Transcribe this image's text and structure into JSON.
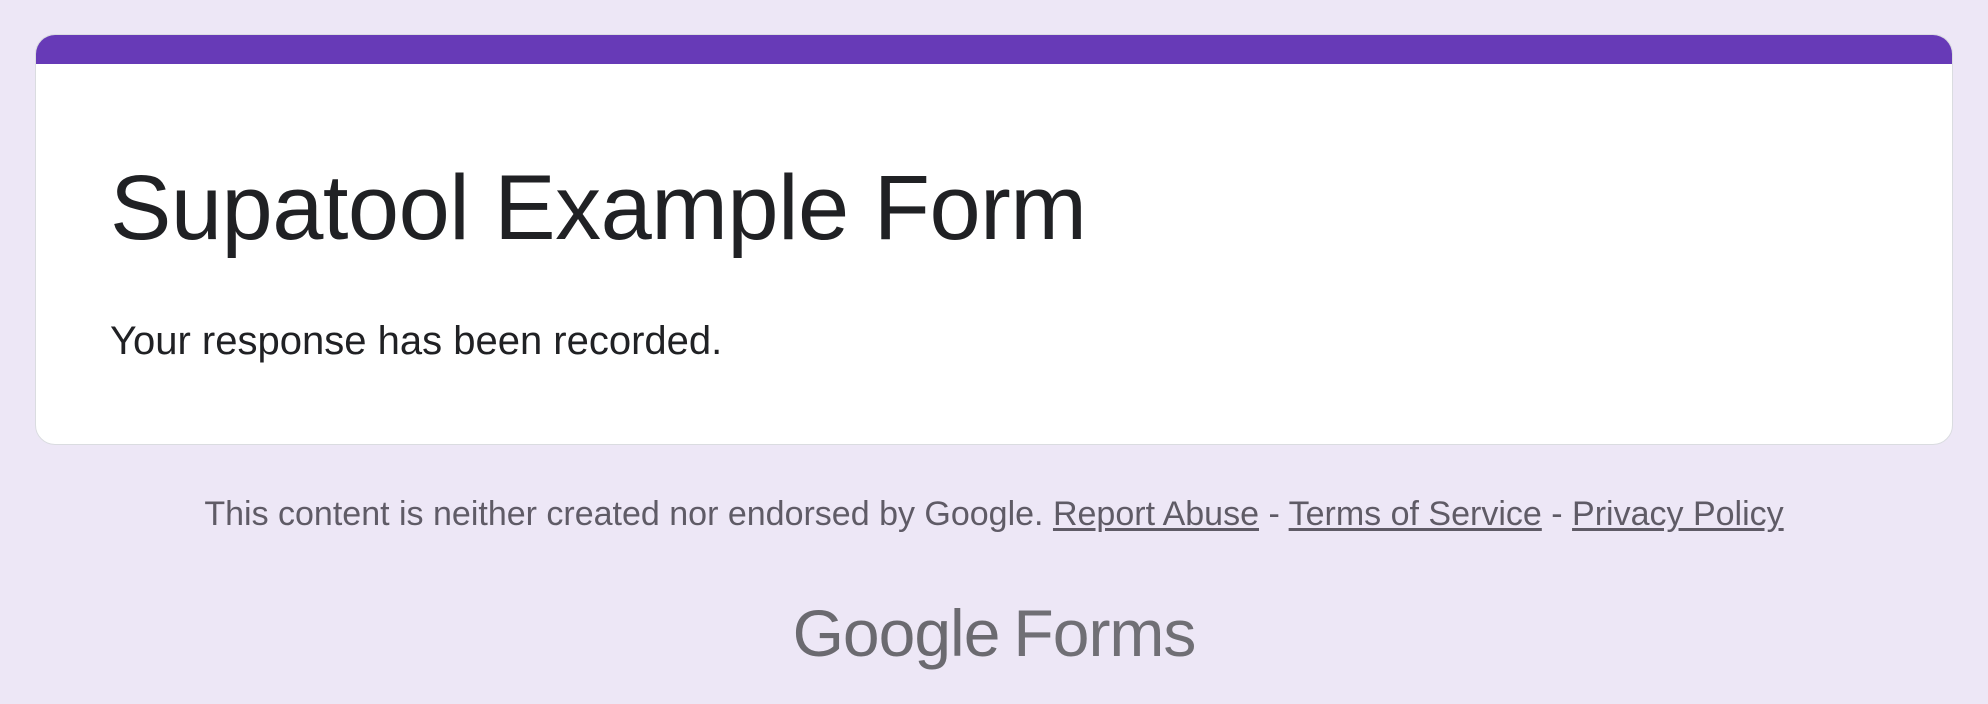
{
  "form": {
    "title": "Supatool Example Form",
    "confirmation_message": "Your response has been recorded."
  },
  "footer": {
    "disclaimer": "This content is neither created nor endorsed by Google.",
    "report_abuse_label": "Report Abuse",
    "separator": "-",
    "terms_label": "Terms of Service",
    "privacy_label": "Privacy Policy"
  },
  "branding": {
    "logo_google": "Google",
    "logo_forms": "Forms"
  },
  "colors": {
    "background": "#ede7f6",
    "accent": "#673ab7",
    "card": "#ffffff",
    "text": "#202124"
  }
}
